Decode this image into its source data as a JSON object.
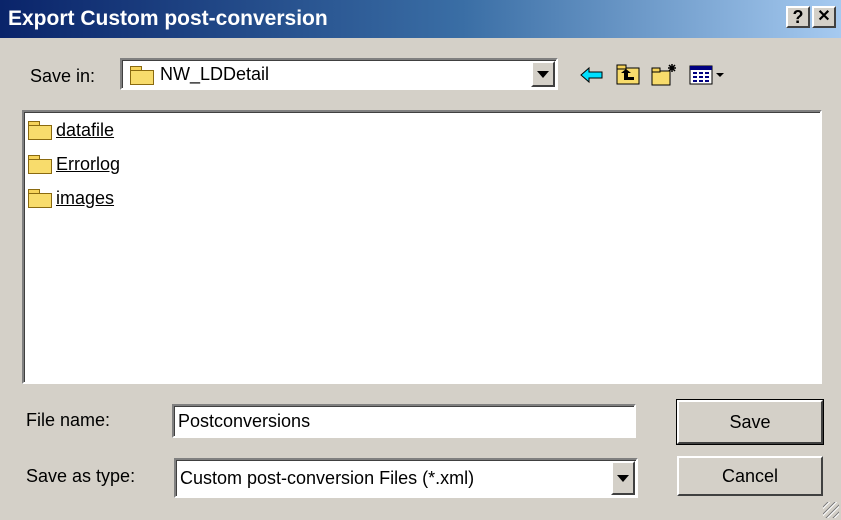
{
  "window": {
    "title": "Export Custom post-conversion",
    "help_label": "?",
    "close_label": "✕"
  },
  "save_in": {
    "label": "Save in:",
    "value": "NW_LDDetail"
  },
  "toolbar": {
    "back_icon": "back-arrow-icon",
    "up_icon": "up-folder-icon",
    "new_folder_icon": "new-folder-icon",
    "view_icon": "view-menu-icon"
  },
  "files": [
    {
      "name": "datafile",
      "type": "folder"
    },
    {
      "name": "Errorlog",
      "type": "folder"
    },
    {
      "name": "images",
      "type": "folder"
    }
  ],
  "file_name": {
    "label": "File name:",
    "value": "Postconversions"
  },
  "save_as_type": {
    "label": "Save as type:",
    "value": "Custom post-conversion Files (*.xml)"
  },
  "buttons": {
    "save": "Save",
    "cancel": "Cancel"
  },
  "colors": {
    "title_bar_start": "#0a246a",
    "title_bar_end": "#a6caf0",
    "dialog_bg": "#d4d0c8"
  }
}
